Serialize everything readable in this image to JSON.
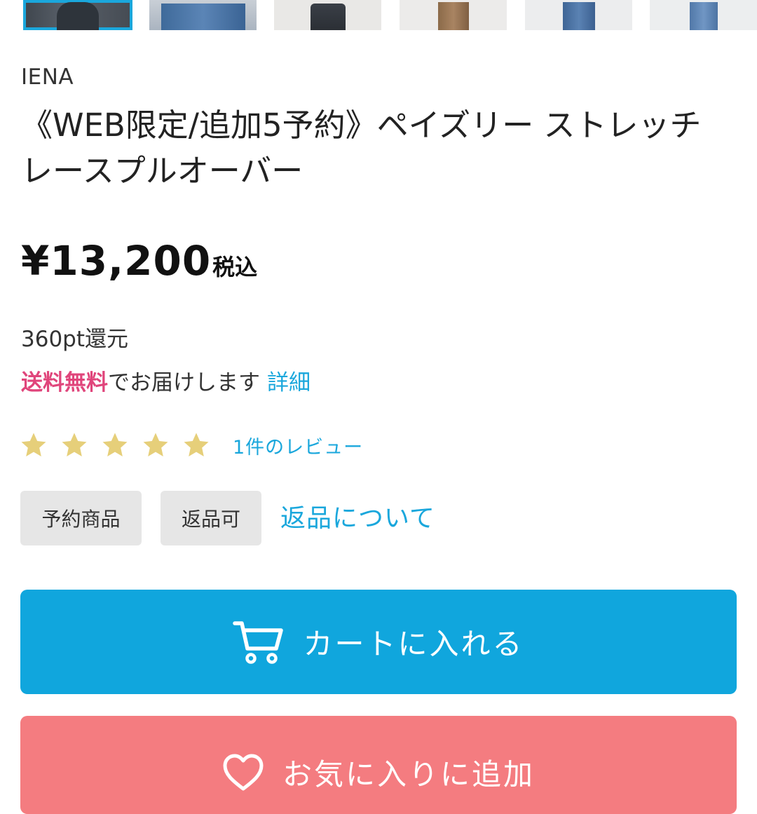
{
  "product": {
    "brand": "IENA",
    "title": "《WEB限定/追加5予約》ペイズリー ストレッチレースプルオーバー",
    "price": "¥13,200",
    "tax_label": "税込",
    "points": "360pt還元",
    "shipping": {
      "free_label": "送料無料",
      "text": "でお届けします",
      "detail_link": "詳細"
    },
    "rating": {
      "stars": 5,
      "max_stars": 5,
      "reviews_label": "1件のレビュー"
    },
    "tags": [
      "予約商品",
      "返品可"
    ],
    "return_link": "返品について"
  },
  "actions": {
    "cart_label": "カートに入れる",
    "favorite_label": "お気に入りに追加"
  },
  "colors": {
    "accent_blue": "#10a6dd",
    "link_blue": "#1aa7dc",
    "free_pink": "#e0457b",
    "favorite_pink": "#f47c80",
    "star_gold": "#e6cf7a",
    "tag_gray": "#e6e6e6"
  },
  "icons": {
    "cart": "cart-icon",
    "favorite": "heart-icon",
    "star": "star-icon"
  }
}
